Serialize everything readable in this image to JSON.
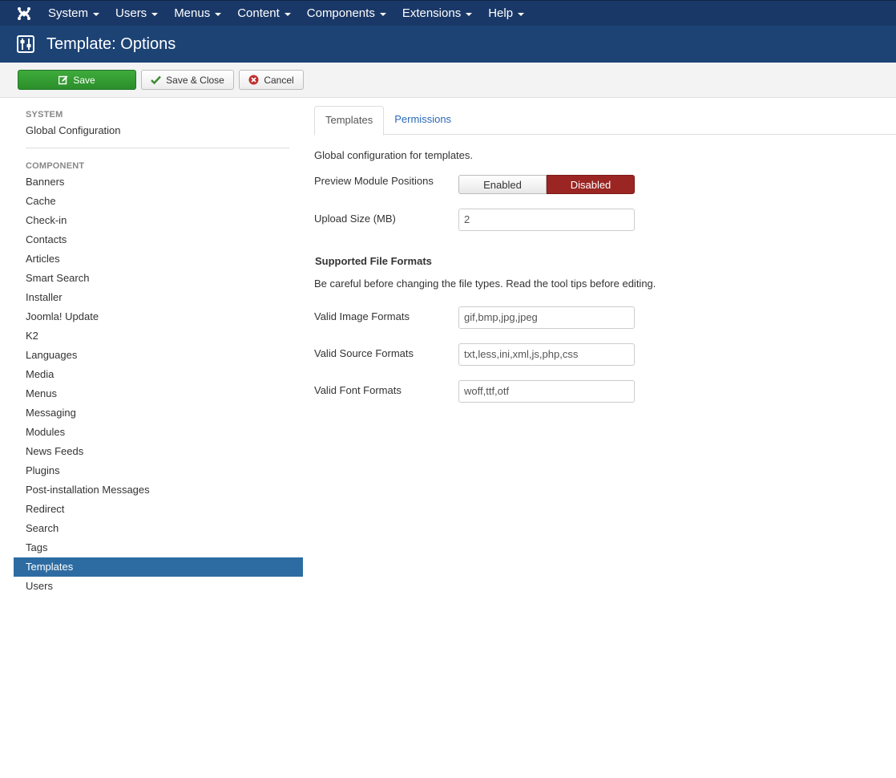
{
  "topnav": {
    "logo_icon": "joomla-logo-icon",
    "items": [
      {
        "label": "System"
      },
      {
        "label": "Users"
      },
      {
        "label": "Menus"
      },
      {
        "label": "Content"
      },
      {
        "label": "Components"
      },
      {
        "label": "Extensions"
      },
      {
        "label": "Help"
      }
    ]
  },
  "header": {
    "icon": "options-sliders-icon",
    "title": "Template: Options"
  },
  "toolbar": {
    "save_label": "Save",
    "save_close_label": "Save & Close",
    "cancel_label": "Cancel"
  },
  "sidebar": {
    "system_heading": "SYSTEM",
    "system_items": [
      {
        "label": "Global Configuration"
      }
    ],
    "component_heading": "COMPONENT",
    "component_items": [
      {
        "label": "Banners"
      },
      {
        "label": "Cache"
      },
      {
        "label": "Check-in"
      },
      {
        "label": "Contacts"
      },
      {
        "label": "Articles"
      },
      {
        "label": "Smart Search"
      },
      {
        "label": "Installer"
      },
      {
        "label": "Joomla! Update"
      },
      {
        "label": "K2"
      },
      {
        "label": "Languages"
      },
      {
        "label": "Media"
      },
      {
        "label": "Menus"
      },
      {
        "label": "Messaging"
      },
      {
        "label": "Modules"
      },
      {
        "label": "News Feeds"
      },
      {
        "label": "Plugins"
      },
      {
        "label": "Post-installation Messages"
      },
      {
        "label": "Redirect"
      },
      {
        "label": "Search"
      },
      {
        "label": "Tags"
      },
      {
        "label": "Templates"
      },
      {
        "label": "Users"
      }
    ],
    "active": "Templates"
  },
  "tabs": [
    {
      "label": "Templates"
    },
    {
      "label": "Permissions"
    }
  ],
  "form": {
    "description": "Global configuration for templates.",
    "preview_label": "Preview Module Positions",
    "preview_enabled": "Enabled",
    "preview_disabled": "Disabled",
    "upload_label": "Upload Size (MB)",
    "upload_value": "2",
    "section_title": "Supported File Formats",
    "section_note": "Be careful before changing the file types. Read the tool tips before editing.",
    "image_label": "Valid Image Formats",
    "image_value": "gif,bmp,jpg,jpeg",
    "source_label": "Valid Source Formats",
    "source_value": "txt,less,ini,xml,js,php,css",
    "font_label": "Valid Font Formats",
    "font_value": "woff,ttf,otf"
  },
  "colors": {
    "nav_bg": "#1a3867",
    "header_bg": "#1d4375",
    "save_green": "#2f9a2f",
    "active_blue": "#2d6ca2",
    "disabled_red": "#9a2522",
    "link_blue": "#2a69b8"
  }
}
